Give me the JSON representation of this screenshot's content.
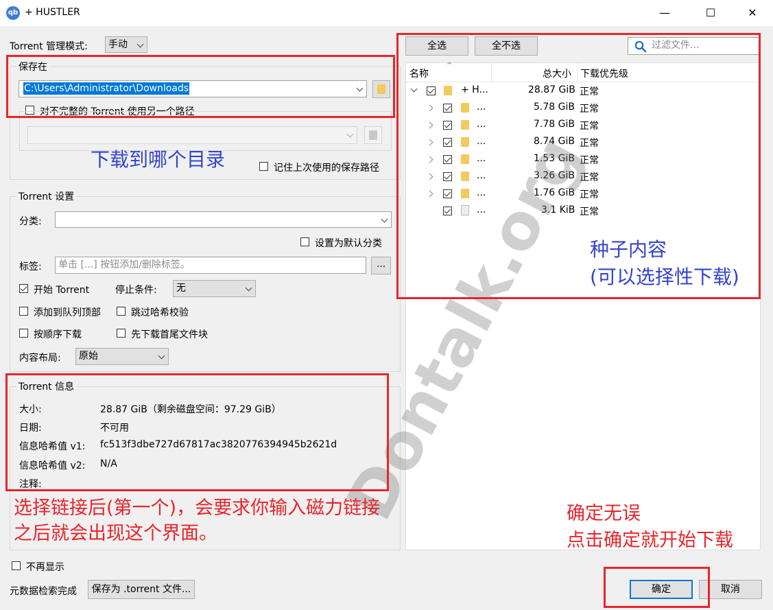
{
  "window": {
    "app_icon": "qb",
    "title": "+ HUSTLER",
    "minimize": "—",
    "maximize": "☐",
    "close": "✕"
  },
  "left": {
    "mgmt_label": "Torrent 管理模式:",
    "mgmt_value": "手动",
    "save_group_title": "保存在",
    "save_path": "C:\\Users\\Administrator\\Downloads",
    "alt_path_label": "对不完整的 Torrent 使用另一个路径",
    "remember_label": "记住上次使用的保存路径",
    "settings_group_title": "Torrent 设置",
    "category_label": "分类:",
    "default_category_label": "设置为默认分类",
    "tags_label": "标签:",
    "tags_placeholder": "单击 [...] 按钮添加/删除标签。",
    "tags_button": "...",
    "start_torrent_label": "开始 Torrent",
    "stop_condition_label": "停止条件:",
    "stop_condition_value": "无",
    "queue_top_label": "添加到队列顶部",
    "skip_hash_label": "跳过哈希校验",
    "sequential_label": "按顺序下载",
    "first_last_label": "先下载首尾文件块",
    "layout_label": "内容布局:",
    "layout_value": "原始",
    "info_group_title": "Torrent 信息",
    "info": {
      "size_label": "大小:",
      "size_value": "28.87 GiB（剩余磁盘空间：97.29 GiB）",
      "date_label": "日期:",
      "date_value": "不可用",
      "hash1_label": "信息哈希值 v1:",
      "hash1_value": "fc513f3dbe727d67817ac3820776394945b2621d",
      "hash2_label": "信息哈希值 v2:",
      "hash2_value": "N/A",
      "comment_label": "注释:"
    }
  },
  "right": {
    "select_all": "全选",
    "select_none": "全不选",
    "filter_placeholder": "过滤文件...",
    "col_name": "名称",
    "col_size": "总大小",
    "col_priority": "下载优先级",
    "rows": [
      {
        "name": "+ H...",
        "size": "28.87 GiB",
        "priority": "正常"
      },
      {
        "name": "...",
        "size": "5.78 GiB",
        "priority": "正常"
      },
      {
        "name": "...",
        "size": "7.78 GiB",
        "priority": "正常"
      },
      {
        "name": "...",
        "size": "8.74 GiB",
        "priority": "正常"
      },
      {
        "name": "...",
        "size": "1.53 GiB",
        "priority": "正常"
      },
      {
        "name": "...",
        "size": "3.26 GiB",
        "priority": "正常"
      },
      {
        "name": "...",
        "size": "1.76 GiB",
        "priority": "正常"
      },
      {
        "name": "...",
        "size": "3.1 KiB",
        "priority": "正常"
      }
    ]
  },
  "bottom": {
    "dont_show_label": "不再显示",
    "status_text": "元数据检索完成",
    "save_torrent_button": "保存为 .torrent 文件...",
    "ok_button": "确定",
    "cancel_button": "取消"
  },
  "annotations": {
    "save_dir_note": "下载到哪个目录",
    "content_note_1": "种子内容",
    "content_note_2": "(可以选择性下载)",
    "link_note_1": "选择链接后(第一个)，会要求你输入磁力链接",
    "link_note_2": "之后就会出现这个界面。",
    "ok_note_1": "确定无误",
    "ok_note_2": "点击确定就开始下载",
    "watermark": "Dontalk.org"
  },
  "colors": {
    "annotation_red": "#e8252b",
    "annotation_blue": "#3344cc",
    "selection_blue": "#0078d7",
    "folder_yellow": "#f4c95d"
  }
}
